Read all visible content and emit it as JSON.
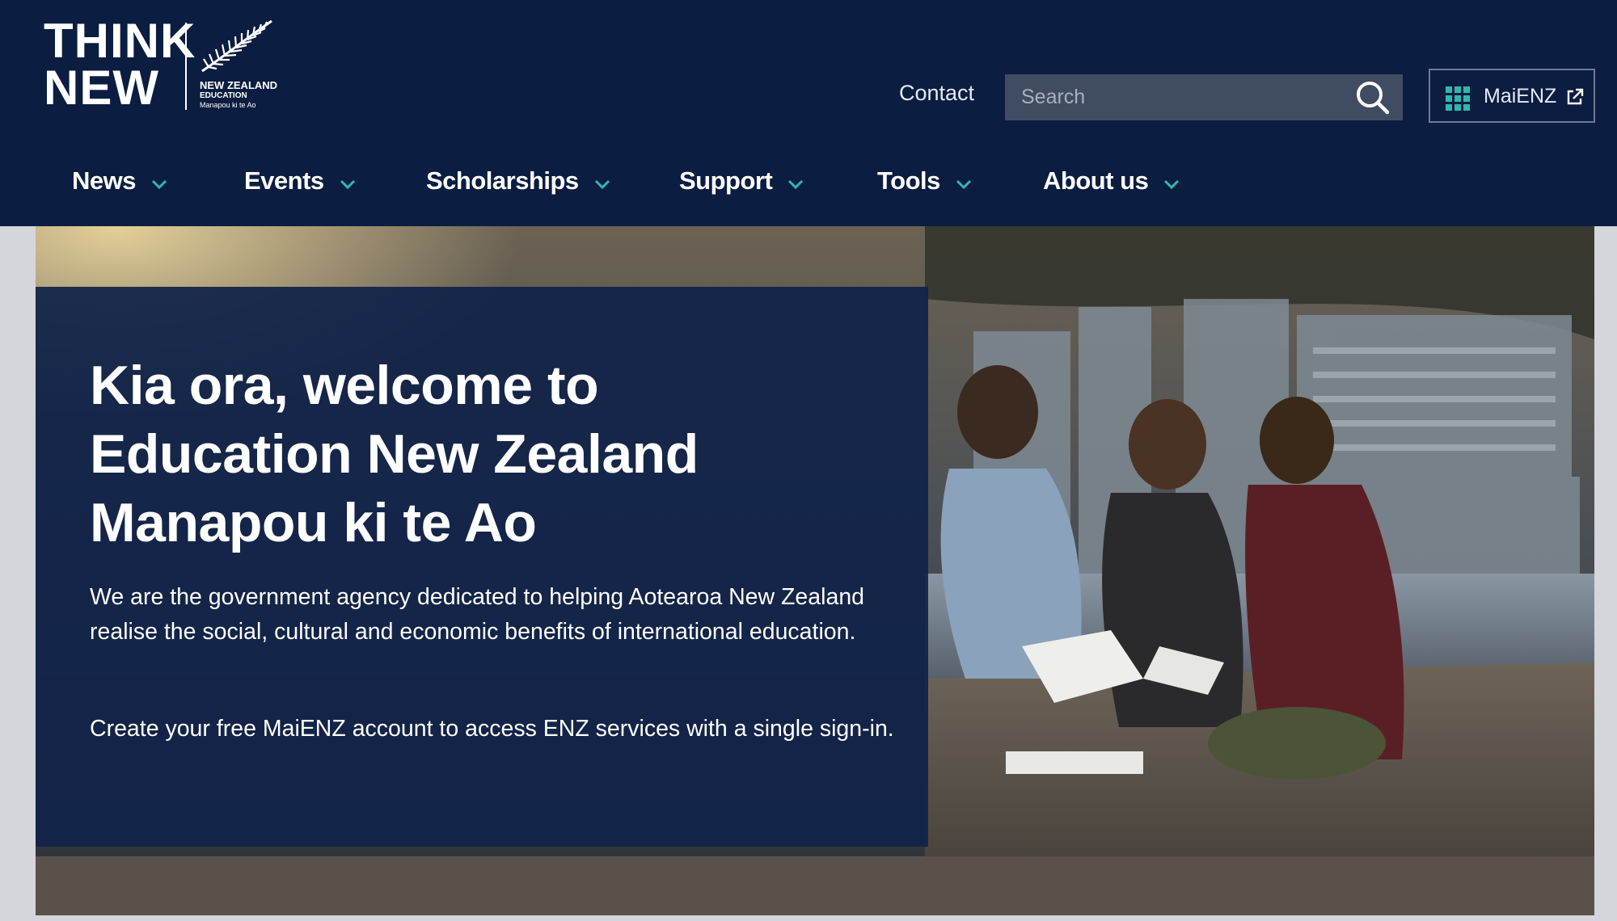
{
  "brand": {
    "logo_line1": "THINK",
    "logo_line2": "NEW",
    "org_line1": "NEW ZEALAND",
    "org_line2": "EDUCATION",
    "org_line3": "Manapou ki te Ao"
  },
  "header": {
    "contact_label": "Contact",
    "search_placeholder": "Search",
    "search_value": "",
    "maienz_label": "MaiENZ"
  },
  "nav": {
    "items": [
      {
        "label": "News"
      },
      {
        "label": "Events"
      },
      {
        "label": "Scholarships"
      },
      {
        "label": "Support"
      },
      {
        "label": "Tools"
      },
      {
        "label": "About us"
      }
    ]
  },
  "hero": {
    "title_line1": "Kia ora, welcome to",
    "title_line2": "Education New Zealand",
    "title_line3": "Manapou ki te Ao",
    "paragraph1": "We are the government agency dedicated to helping Aotearoa New Zealand realise the social, cultural and economic benefits of international education.",
    "paragraph2": "Create your free MaiENZ account to access ENZ services with a single sign-in."
  },
  "icons": {
    "search": "search-icon",
    "chevron": "chevron-down-icon",
    "grid": "grid-icon",
    "external": "external-link-icon",
    "fern": "silver-fern-icon"
  },
  "colors": {
    "header_bg": "#0b1d40",
    "accent_teal": "#2fb8b0",
    "panel_bg": "#102248",
    "search_bg": "#404c61"
  }
}
